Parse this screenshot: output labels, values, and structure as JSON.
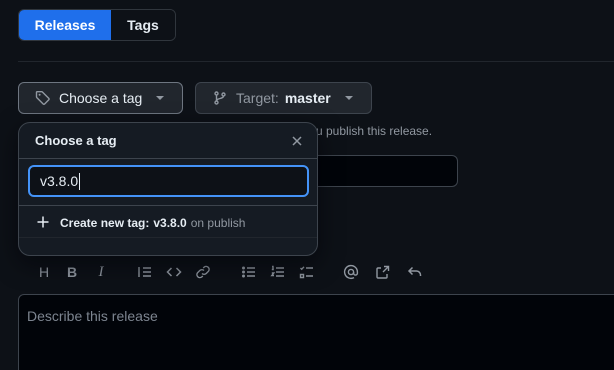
{
  "tabs": [
    {
      "label": "Releases",
      "selected": true
    },
    {
      "label": "Tags",
      "selected": false
    }
  ],
  "tag_button": {
    "label": "Choose a tag",
    "icon": "tag-icon"
  },
  "target_button": {
    "prefix": "Target:",
    "value": "master",
    "icon": "git-branch-icon"
  },
  "hint_text": "u publish this release.",
  "toolbar": {
    "icons": [
      "heading-icon",
      "bold-icon",
      "italic-icon",
      "quote-icon",
      "code-icon",
      "link-icon",
      "bulleted-list-icon",
      "numbered-list-icon",
      "task-list-icon",
      "mention-icon",
      "cross-reference-icon",
      "undo-icon"
    ],
    "glyphs": {
      "heading": "H",
      "bold": "B",
      "italic": "I"
    }
  },
  "editor": {
    "placeholder": "Describe this release"
  },
  "menu": {
    "title": "Choose a tag",
    "filter_value": "v3.8.0",
    "create_prefix": "Create new tag:",
    "create_tag": "v3.8.0",
    "create_suffix": "on publish"
  },
  "colors": {
    "accent": "#1f6feb",
    "focus": "#4493f8",
    "background": "#0d1117"
  }
}
